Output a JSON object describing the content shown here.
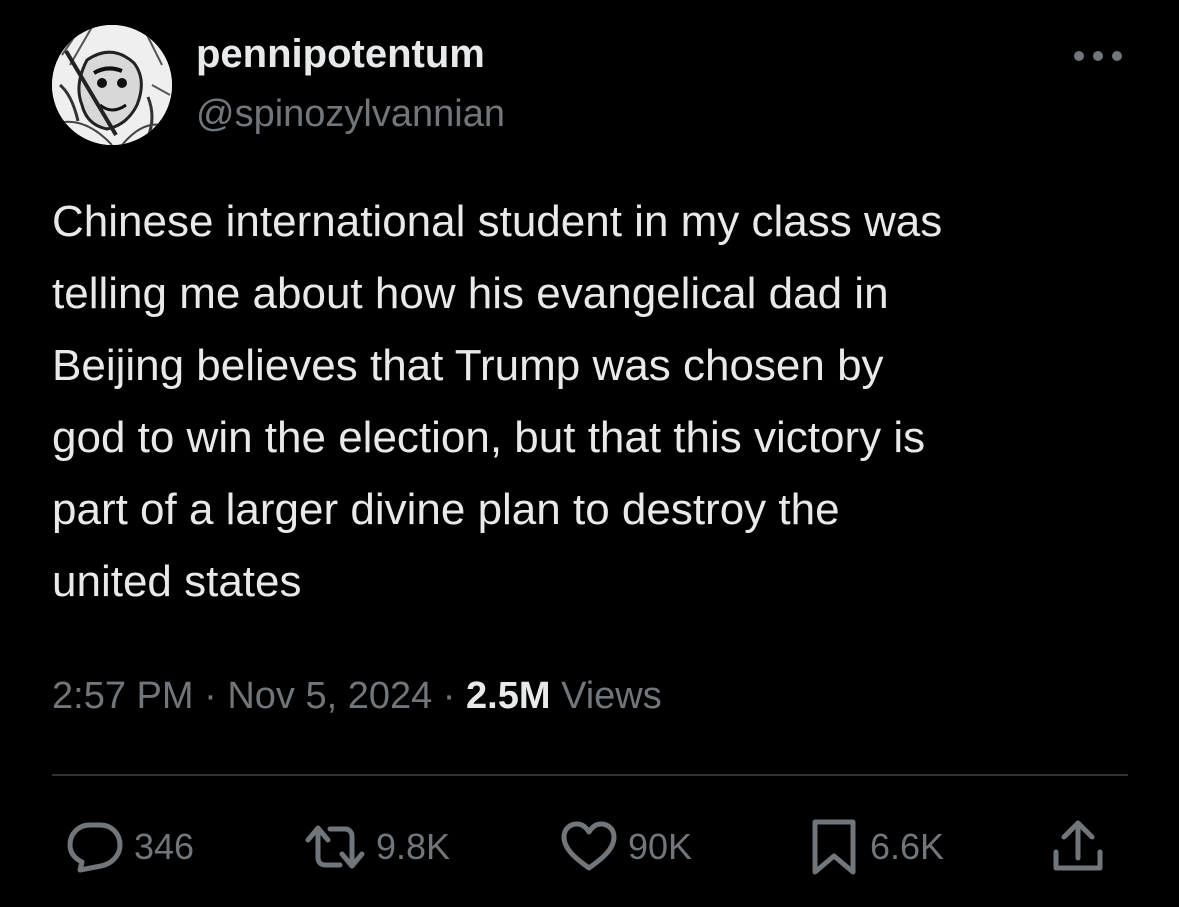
{
  "author": {
    "display_name": "pennipotentum",
    "handle": "@spinozylvannian",
    "avatar_icon": "manga-character-avatar"
  },
  "more_icon": "more-horizontal-icon",
  "tweet": {
    "text": "Chinese international student in my class was\ntelling me about how his evangelical dad in\nBeijing believes that Trump was chosen by\ngod to win the election, but that this victory is\npart of a larger divine plan to destroy the\nunited states"
  },
  "meta": {
    "time": "2:57 PM",
    "separator": "·",
    "date": "Nov 5, 2024",
    "views_count": "2.5M",
    "views_label": "Views"
  },
  "actions": {
    "replies": {
      "icon": "reply-icon",
      "count": "346"
    },
    "retweets": {
      "icon": "retweet-icon",
      "count": "9.8K"
    },
    "likes": {
      "icon": "heart-icon",
      "count": "90K"
    },
    "bookmarks": {
      "icon": "bookmark-icon",
      "count": "6.6K"
    },
    "share": {
      "icon": "share-icon"
    }
  },
  "colors": {
    "background": "#000000",
    "primary_text": "#e7e9ea",
    "secondary_text": "#71767b",
    "divider": "#2f3336"
  }
}
